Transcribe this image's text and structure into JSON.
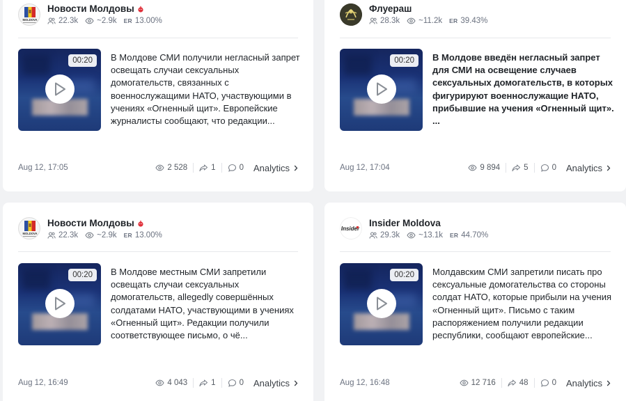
{
  "posts": [
    {
      "channel": "Новости Молдовы",
      "badge": "bomb-emoji",
      "avatar": "moldova-news-avatar",
      "subscribers": "22.3k",
      "views_avg": "~2.9k",
      "er_label": "ER",
      "er": "13.00%",
      "duration": "00:20",
      "text": "В Молдове СМИ получили негласный запрет освещать случаи сексуальных домогательств, связанных с военнослужащими НАТО, участвующими в учениях «Огненный щит». Европейские журналисты сообщают, что редакции...",
      "bold": false,
      "date": "Aug 12, 17:05",
      "views": "2 528",
      "shares": "1",
      "comments": "0",
      "analytics": "Analytics"
    },
    {
      "channel": "Флуераш",
      "badge": "",
      "avatar": "fluerash-avatar",
      "subscribers": "28.3k",
      "views_avg": "~11.2k",
      "er_label": "ER",
      "er": "39.43%",
      "duration": "00:20",
      "text": "В Молдове введён негласный запрет для СМИ на освещение случаев сексуальных домогательств, в которых фигурируют военнослужащие НАТО, прибывшие на учения «Огненный щит».\n...",
      "bold": true,
      "date": "Aug 12, 17:04",
      "views": "9 894",
      "shares": "5",
      "comments": "0",
      "analytics": "Analytics"
    },
    {
      "channel": "Новости Молдовы",
      "badge": "bomb-emoji",
      "avatar": "moldova-news-avatar",
      "subscribers": "22.3k",
      "views_avg": "~2.9k",
      "er_label": "ER",
      "er": "13.00%",
      "duration": "00:20",
      "text": "В Молдове местным СМИ запретили освещать случаи сексуальных домогательств, allegedly совершённых солдатами НАТО, участвующими в учениях «Огненный щит». Редакции получили соответствующее письмо, о чё...",
      "bold": false,
      "date": "Aug 12, 16:49",
      "views": "4 043",
      "shares": "1",
      "comments": "0",
      "analytics": "Analytics"
    },
    {
      "channel": "Insider Moldova",
      "badge": "",
      "avatar": "insider-moldova-avatar",
      "subscribers": "29.3k",
      "views_avg": "~13.1k",
      "er_label": "ER",
      "er": "44.70%",
      "duration": "00:20",
      "text": "Молдавским СМИ запретили писать про сексуальные домогательства со стороны солдат НАТО, которые прибыли на учения «Огненный щит». Письмо с таким распоряжением получили редакции республики, сообщают европейские...",
      "bold": false,
      "date": "Aug 12, 16:48",
      "views": "12 716",
      "shares": "48",
      "comments": "0",
      "analytics": "Analytics"
    }
  ],
  "avatar_logo_text": {
    "moldova": "MOLDOVA",
    "insider": "Insider"
  }
}
